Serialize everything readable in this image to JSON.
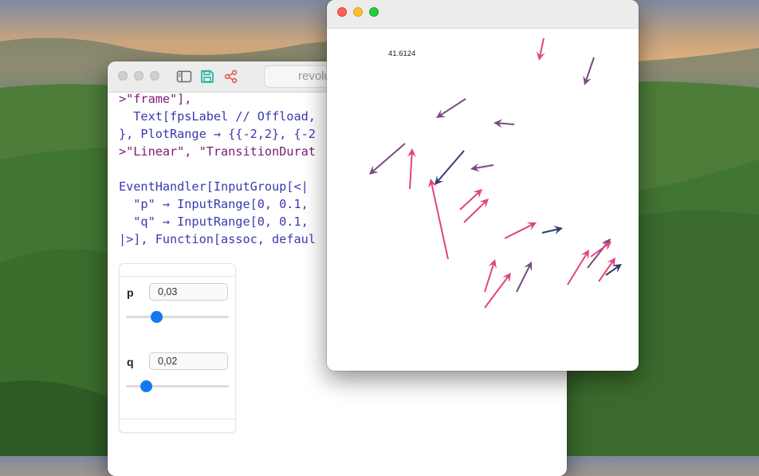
{
  "editor": {
    "address_text": "revolu",
    "code_lines": [
      [
        {
          "t": ">\"frame\"],",
          "c": "str"
        }
      ],
      [
        {
          "t": "  Text[fpsLabel // Offload,",
          "c": "fn"
        }
      ],
      [
        {
          "t": "}, PlotRange → {{-2,2}, {-2",
          "c": "fn"
        }
      ],
      [
        {
          "t": ">\"Linear\", \"TransitionDurat",
          "c": "str"
        }
      ],
      [
        {
          "t": "",
          "c": ""
        }
      ],
      [
        {
          "t": "EventHandler[InputGroup[<|",
          "c": "fn"
        }
      ],
      [
        {
          "t": "  \"p\" → InputRange[0, 0.1,",
          "c": "fn"
        }
      ],
      [
        {
          "t": "  \"q\" → InputRange[0, 0.1,",
          "c": "fn"
        }
      ],
      [
        {
          "t": "|>], Function[assoc, defaul",
          "c": "fn"
        }
      ]
    ],
    "p_label": "p",
    "p_value": "0,03",
    "p_fraction": 0.3,
    "q_label": "q",
    "q_value": "0,02",
    "q_fraction": 0.2
  },
  "plot_window": {
    "fps_label": "41.6124"
  },
  "icons": {
    "sidebar": "sidebar-icon",
    "save": "save-icon",
    "share": "share-icon"
  },
  "colors": {
    "accent_blue": "#1479f0",
    "save_teal": "#1db3a3",
    "share_red": "#e2584f",
    "arrow_pink": "#e0457a",
    "arrow_purple": "#7a4a82",
    "arrow_navy": "#2b3f6e"
  }
}
